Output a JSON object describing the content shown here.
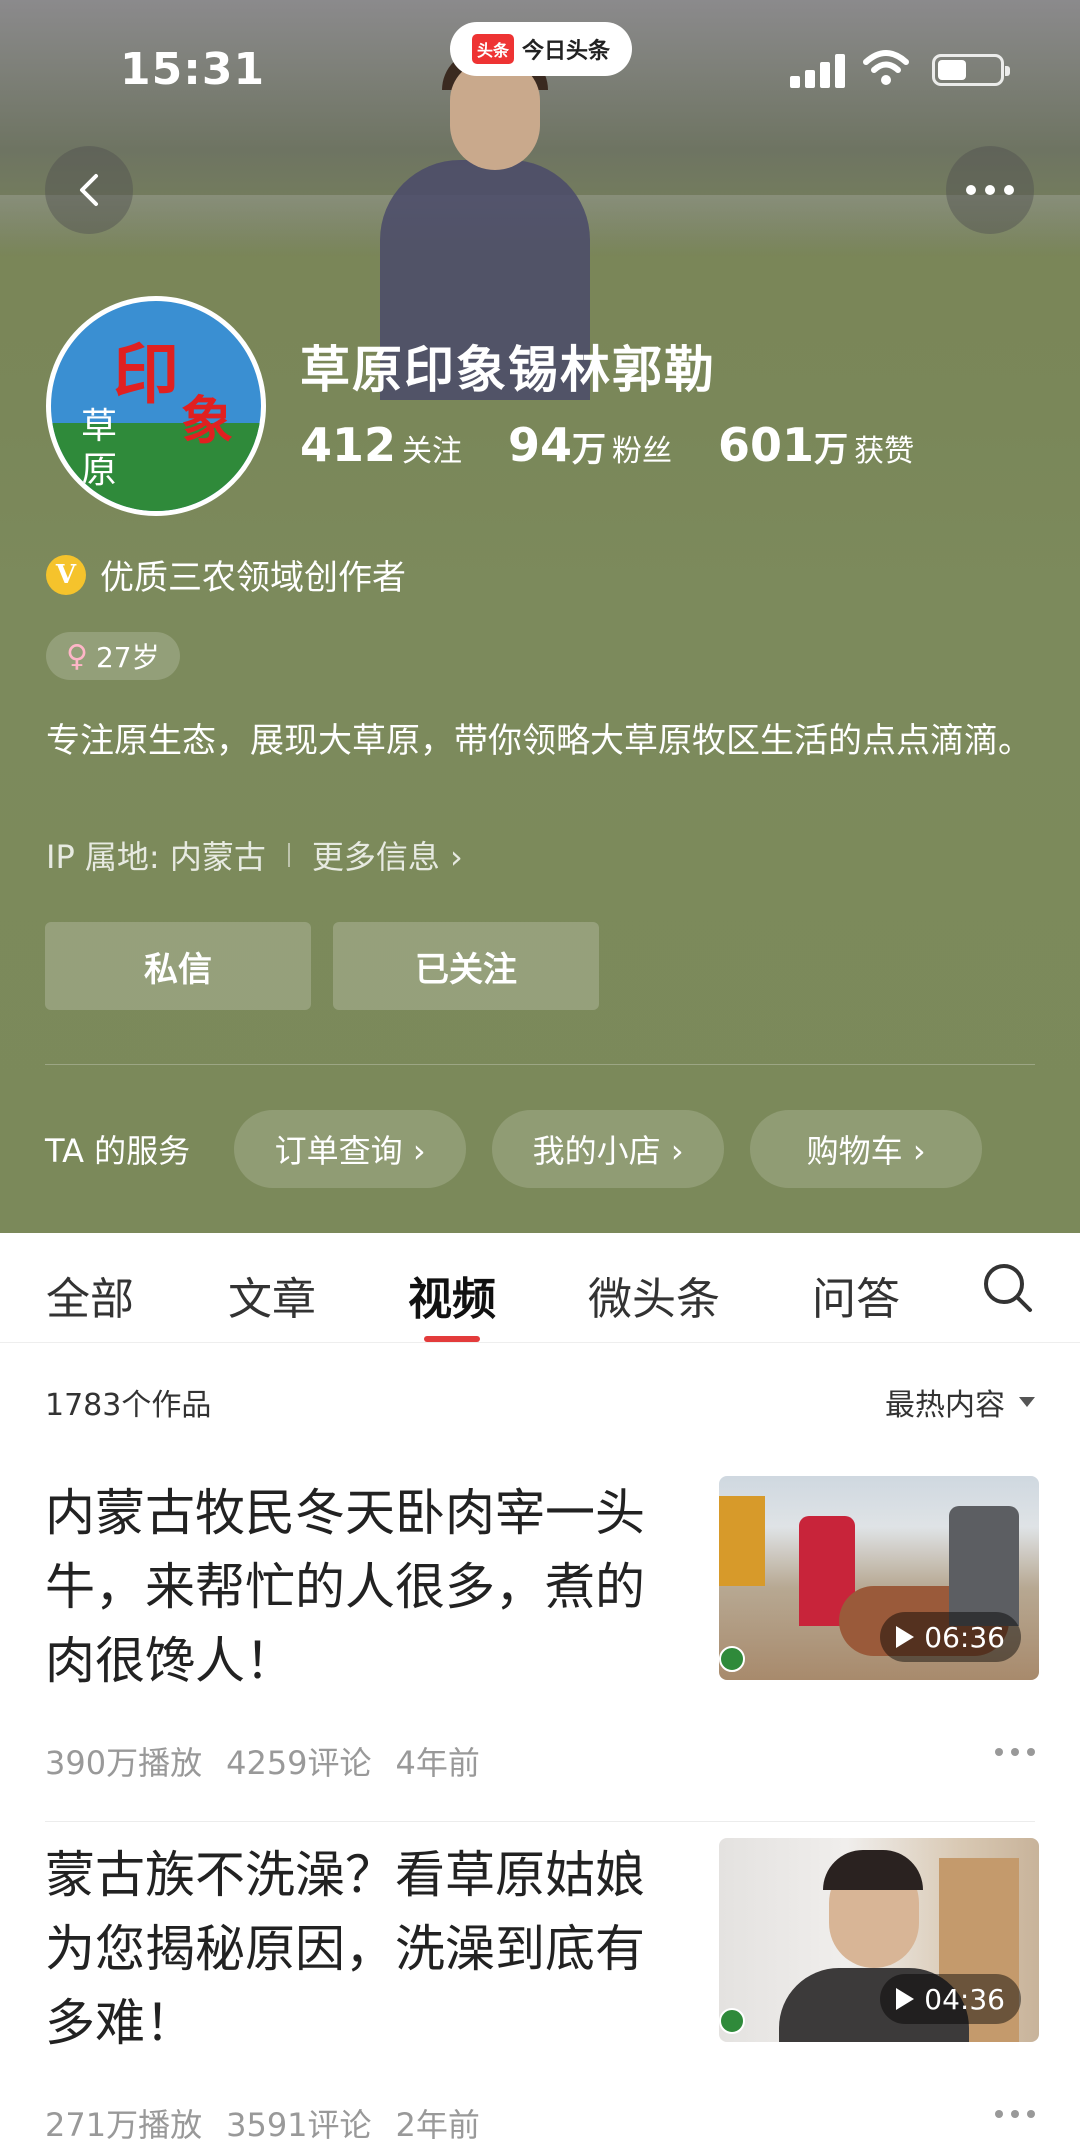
{
  "status_bar": {
    "time": "15:31",
    "app_logo": "头条",
    "app_name": "今日头条"
  },
  "profile": {
    "name": "草原印象锡林郭勒",
    "avatar_chars": [
      "印",
      "象",
      "草",
      "原"
    ],
    "stats": [
      {
        "num": "412",
        "unit": "",
        "label": "关注"
      },
      {
        "num": "94",
        "unit": "万",
        "label": "粉丝"
      },
      {
        "num": "601",
        "unit": "万",
        "label": "获赞"
      }
    ],
    "verify_icon": "V",
    "verify_text": "优质三农领域创作者",
    "age_symbol": "♀",
    "age": "27岁",
    "bio": "专注原生态，展现大草原，带你领略大草原牧区生活的点点滴滴。",
    "ip": "IP 属地: 内蒙古",
    "more_info": "更多信息 ›",
    "buttons": {
      "message": "私信",
      "followed": "已关注"
    }
  },
  "services": {
    "label": "TA 的服务",
    "items": [
      "订单查询 ›",
      "我的小店 ›",
      "购物车 ›"
    ]
  },
  "tabs": [
    "全部",
    "文章",
    "视频",
    "微头条",
    "问答"
  ],
  "active_tab": "视频",
  "works": {
    "count": "1783个作品",
    "sort": "最热内容"
  },
  "items": [
    {
      "title": "内蒙古牧民冬天卧肉宰一头牛，来帮忙的人很多，煮的肉很馋人！",
      "duration": "06:36",
      "plays": "390万播放",
      "comments": "4259评论",
      "time": "4年前"
    },
    {
      "title": "蒙古族不洗澡？看草原姑娘为您揭秘原因，洗澡到底有多难！",
      "duration": "04:36",
      "plays": "271万播放",
      "comments": "3591评论",
      "time": "2年前"
    }
  ],
  "colors": {
    "header_bg": "#7b895a",
    "accent_red": "#e33b3b",
    "verify_gold": "#f5c32c"
  }
}
